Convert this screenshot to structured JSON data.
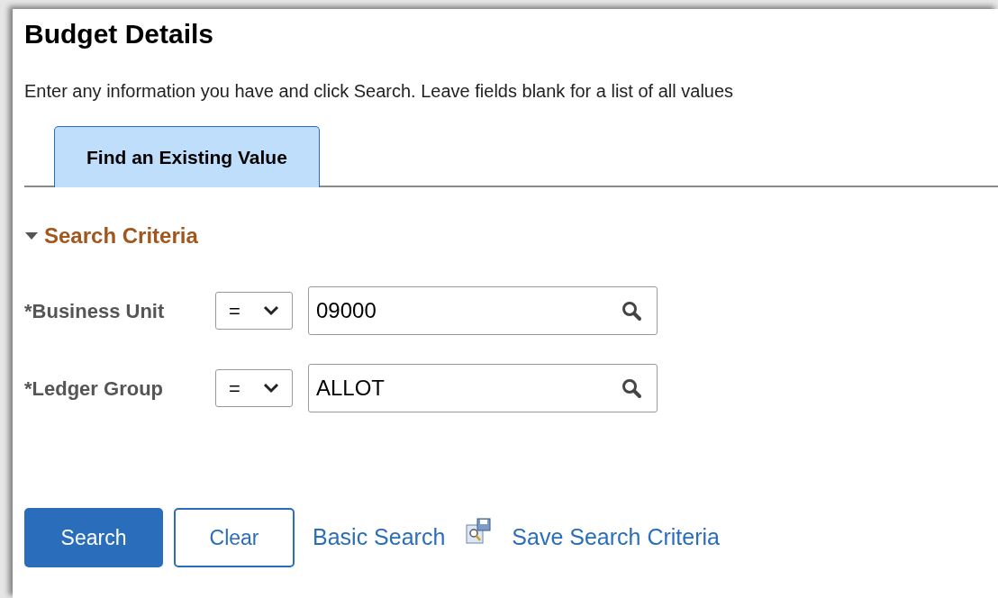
{
  "page": {
    "title": "Budget Details",
    "instructions": "Enter any information you have and click Search. Leave fields blank for a list of all values"
  },
  "tabs": [
    {
      "label": "Find an Existing Value",
      "selected": true
    }
  ],
  "search_criteria": {
    "title": "Search Criteria",
    "expanded": true,
    "fields": [
      {
        "label": "*Business Unit",
        "operator": "=",
        "value": "09000"
      },
      {
        "label": "*Ledger Group",
        "operator": "=",
        "value": "ALLOT"
      }
    ]
  },
  "buttons": [
    {
      "label": "Search",
      "kind": "primary"
    },
    {
      "label": "Clear",
      "kind": "secondary"
    }
  ],
  "links": [
    {
      "label": "Basic Search",
      "kind": "plain"
    },
    {
      "label": "Save Search Criteria",
      "kind": "icon"
    }
  ]
}
